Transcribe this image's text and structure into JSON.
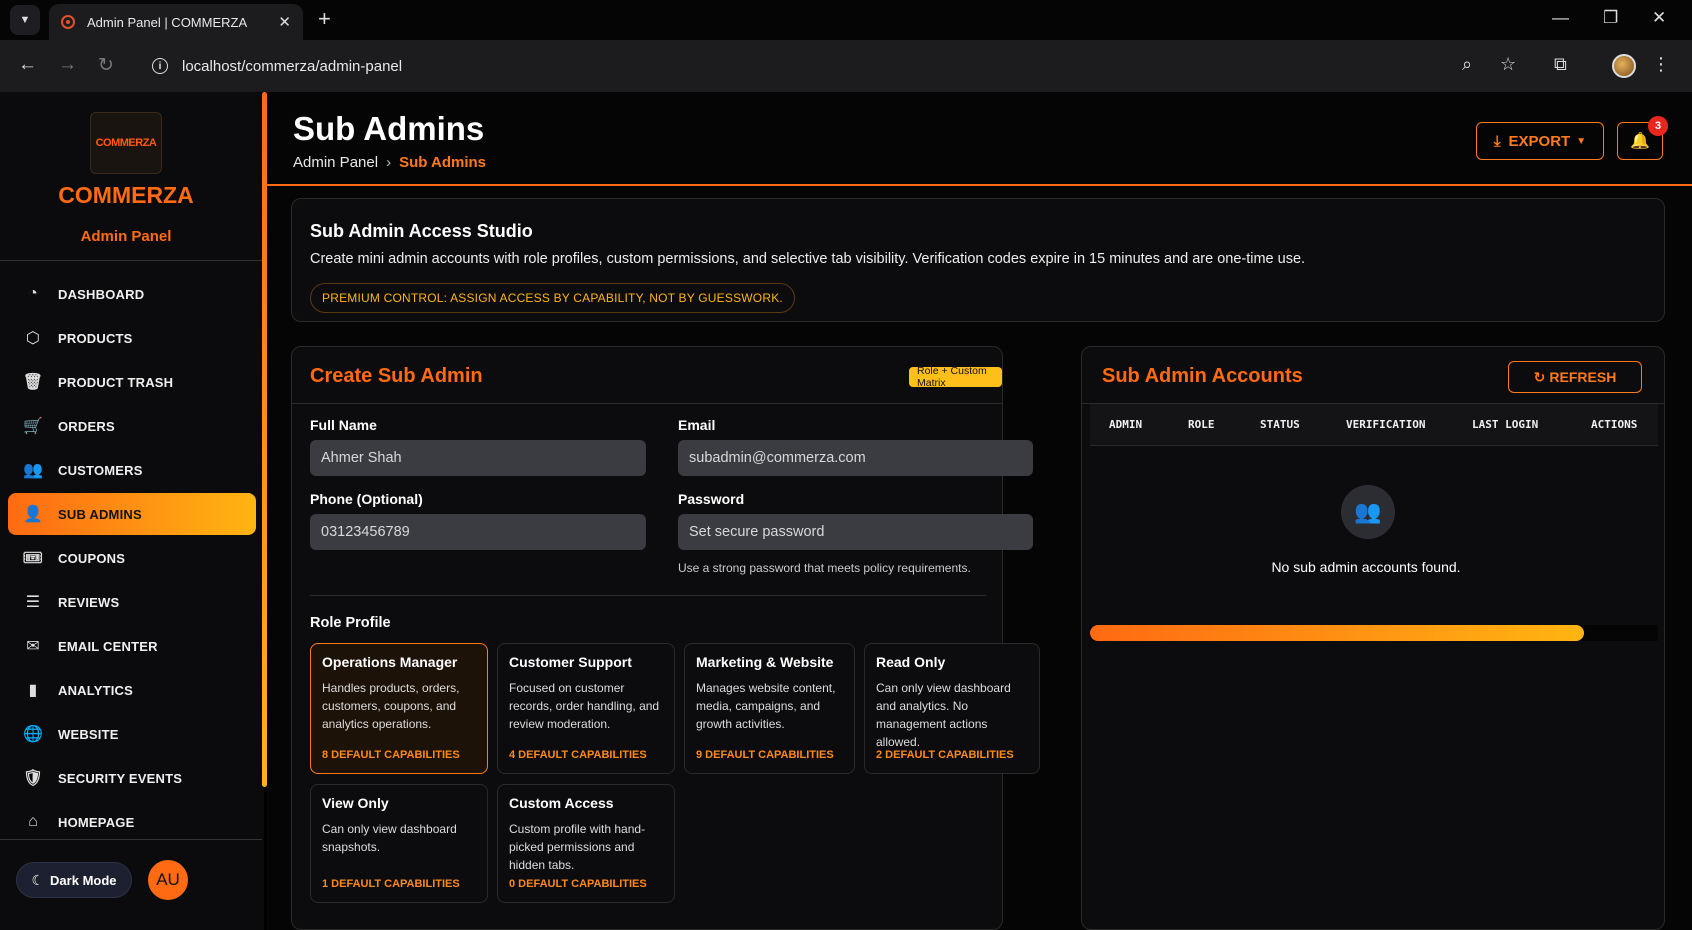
{
  "browser": {
    "tab_title": "Admin Panel | COMMERZA",
    "url": "localhost/commerza/admin-panel"
  },
  "sidebar": {
    "logo_text": "COMMERZA",
    "brand": "COMMERZA",
    "subtitle": "Admin Panel",
    "items": [
      {
        "label": "DASHBOARD",
        "icon": "dashboard-icon",
        "glyph": "◔"
      },
      {
        "label": "PRODUCTS",
        "icon": "box-icon",
        "glyph": "⬡"
      },
      {
        "label": "PRODUCT TRASH",
        "icon": "trash-icon",
        "glyph": "🗑"
      },
      {
        "label": "ORDERS",
        "icon": "cart-icon",
        "glyph": "🛒"
      },
      {
        "label": "CUSTOMERS",
        "icon": "users-icon",
        "glyph": "👥"
      },
      {
        "label": "SUB ADMINS",
        "icon": "user-gear-icon",
        "glyph": "👤"
      },
      {
        "label": "COUPONS",
        "icon": "ticket-icon",
        "glyph": "🎟"
      },
      {
        "label": "REVIEWS",
        "icon": "message-icon",
        "glyph": "☰"
      },
      {
        "label": "EMAIL CENTER",
        "icon": "mail-icon",
        "glyph": "✉"
      },
      {
        "label": "ANALYTICS",
        "icon": "chart-icon",
        "glyph": "▮"
      },
      {
        "label": "WEBSITE",
        "icon": "globe-icon",
        "glyph": "🌐"
      },
      {
        "label": "SECURITY EVENTS",
        "icon": "shield-icon",
        "glyph": "🛡"
      },
      {
        "label": "HOMEPAGE",
        "icon": "home-icon",
        "glyph": "⌂"
      }
    ],
    "active": "SUB ADMINS",
    "dark_mode_label": "Dark Mode",
    "avatar_initials": "AU"
  },
  "header": {
    "title": "Sub Admins",
    "breadcrumb": [
      "Admin Panel",
      "Sub Admins"
    ],
    "export_label": "EXPORT",
    "notification_count": "3"
  },
  "studio": {
    "title": "Sub Admin Access Studio",
    "description": "Create mini admin accounts with role profiles, custom permissions, and selective tab visibility. Verification codes expire in 15 minutes and are one-time use.",
    "pill": "PREMIUM CONTROL: ASSIGN ACCESS BY CAPABILITY, NOT BY GUESSWORK."
  },
  "create": {
    "title": "Create Sub Admin",
    "tag": "Role + Custom Matrix",
    "full_name_label": "Full Name",
    "full_name_placeholder": "Ahmer Shah",
    "email_label": "Email",
    "email_placeholder": "subadmin@commerza.com",
    "phone_label": "Phone (Optional)",
    "phone_placeholder": "03123456789",
    "password_label": "Password",
    "password_placeholder": "Set secure password",
    "password_hint": "Use a strong password that meets policy requirements.",
    "role_profile_label": "Role Profile",
    "roles": [
      {
        "name": "Operations Manager",
        "desc": "Handles products, orders, customers, coupons, and analytics operations.",
        "caps": "8 DEFAULT CAPABILITIES",
        "selected": true
      },
      {
        "name": "Customer Support",
        "desc": "Focused on customer records, order handling, and review moderation.",
        "caps": "4 DEFAULT CAPABILITIES",
        "selected": false
      },
      {
        "name": "Marketing & Website",
        "desc": "Manages website content, media, campaigns, and growth activities.",
        "caps": "9 DEFAULT CAPABILITIES",
        "selected": false
      },
      {
        "name": "Read Only",
        "desc": "Can only view dashboard and analytics. No management actions allowed.",
        "caps": "2 DEFAULT CAPABILITIES",
        "selected": false
      },
      {
        "name": "View Only",
        "desc": "Can only view dashboard snapshots.",
        "caps": "1 DEFAULT CAPABILITIES",
        "selected": false
      },
      {
        "name": "Custom Access",
        "desc": "Custom profile with hand-picked permissions and hidden tabs.",
        "caps": "0 DEFAULT CAPABILITIES",
        "selected": false
      }
    ]
  },
  "accounts": {
    "title": "Sub Admin Accounts",
    "refresh_label": "REFRESH",
    "columns": [
      "ADMIN",
      "ROLE",
      "STATUS",
      "VERIFICATION",
      "LAST LOGIN",
      "ACTIONS"
    ],
    "empty_text": "No sub admin accounts found.",
    "progress_fraction": 0.87
  },
  "colors": {
    "accent": "#ff6a13",
    "accent2": "#ffb511",
    "badge": "#e8261e"
  }
}
